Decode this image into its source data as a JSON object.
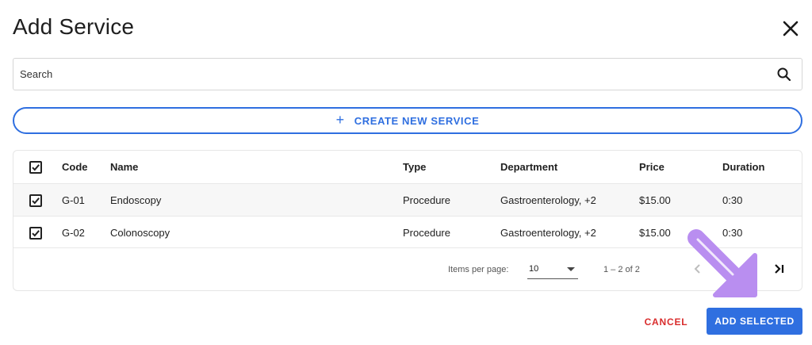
{
  "dialog": {
    "title": "Add Service"
  },
  "search": {
    "placeholder": "Search"
  },
  "create_button": {
    "label": "CREATE NEW SERVICE"
  },
  "table": {
    "columns": [
      "Code",
      "Name",
      "Type",
      "Department",
      "Price",
      "Duration"
    ],
    "rows": [
      {
        "checked": true,
        "code": "G-01",
        "name": "Endoscopy",
        "type": "Procedure",
        "department": "Gastroenterology, +2",
        "price": "$15.00",
        "duration": "0:30"
      },
      {
        "checked": true,
        "code": "G-02",
        "name": "Colonoscopy",
        "type": "Procedure",
        "department": "Gastroenterology, +2",
        "price": "$15.00",
        "duration": "0:30"
      }
    ],
    "header_checked": true
  },
  "pagination": {
    "items_per_page_label": "Items per page:",
    "items_per_page_value": "10",
    "range_label": "1 – 2 of 2"
  },
  "footer": {
    "cancel_label": "CANCEL",
    "add_label": "ADD SELECTED"
  },
  "colors": {
    "accent": "#2f6fe0",
    "danger": "#d92c2c",
    "pointer": "#b98ef0"
  },
  "icons": [
    "close-icon",
    "search-icon",
    "plus-icon",
    "checkbox-checked-icon",
    "chevron-left-icon",
    "chevron-right-icon",
    "last-page-icon",
    "dropdown-caret-icon",
    "pointer-arrow-icon"
  ]
}
